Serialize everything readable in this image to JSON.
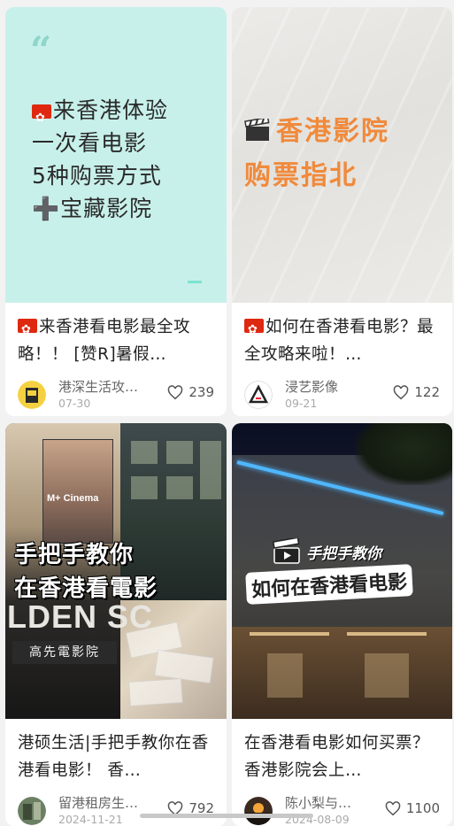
{
  "cards": [
    {
      "cover": {
        "quote": "“",
        "flag_prefix": "🇭🇰",
        "lines": [
          "来香港体验",
          "一次看电影",
          "5种购票方式",
          "➕宝藏影院"
        ]
      },
      "title": "来香港看电影最全攻略！！ [赞R]暑假…",
      "author": "港深生活攻…",
      "date": "07-30",
      "likes": "239"
    },
    {
      "cover": {
        "lines": [
          "香港影院",
          "购票指北"
        ]
      },
      "title": "如何在香港看电影？最全攻略来啦！…",
      "author": "浸艺影像",
      "date": "09-21",
      "likes": "122"
    },
    {
      "cover": {
        "poster_label": "M+ Cinema",
        "sign": "LDEN SC",
        "sign_cn": "高先電影院",
        "lines": [
          "手把手教你",
          "在香港看電影"
        ]
      },
      "title": "港硕生活|手把手教你在香港看电影！ 香…",
      "author": "留港租房生…",
      "date": "2024-11-21",
      "likes": "792"
    },
    {
      "cover": {
        "sub": "手把手教你",
        "main": "如何在香港看电影"
      },
      "title": "在香港看电影如何买票？ 香港影院会上…",
      "author": "陈小梨与…",
      "date": "2024-08-09",
      "likes": "1100"
    }
  ],
  "icons": {
    "like": "heart-outline-icon",
    "clapper": "clapperboard-icon"
  },
  "colors": {
    "mint": "#c8f0ea",
    "orange": "#f08a3c",
    "flag_red": "#de2910"
  }
}
